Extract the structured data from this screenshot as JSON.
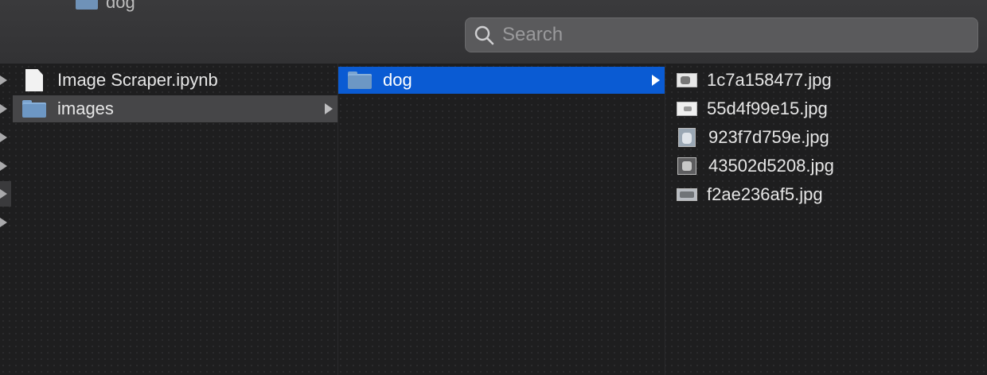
{
  "toolbar": {
    "crumb_label": "dog",
    "search_placeholder": "Search"
  },
  "columns": {
    "col1": [
      {
        "name": "Image Scraper.ipynb",
        "kind": "file"
      },
      {
        "name": "images",
        "kind": "folder",
        "selected": "inactive"
      }
    ],
    "col2": [
      {
        "name": "dog",
        "kind": "folder",
        "selected": "active"
      }
    ],
    "col3": [
      {
        "name": "1c7a158477.jpg"
      },
      {
        "name": "55d4f99e15.jpg"
      },
      {
        "name": "923f7d759e.jpg"
      },
      {
        "name": "43502d5208.jpg"
      },
      {
        "name": "f2ae236af5.jpg"
      }
    ]
  },
  "colors": {
    "active_selection": "#0a5bd3",
    "inactive_selection": "#464648",
    "folder": "#6d97c4"
  }
}
